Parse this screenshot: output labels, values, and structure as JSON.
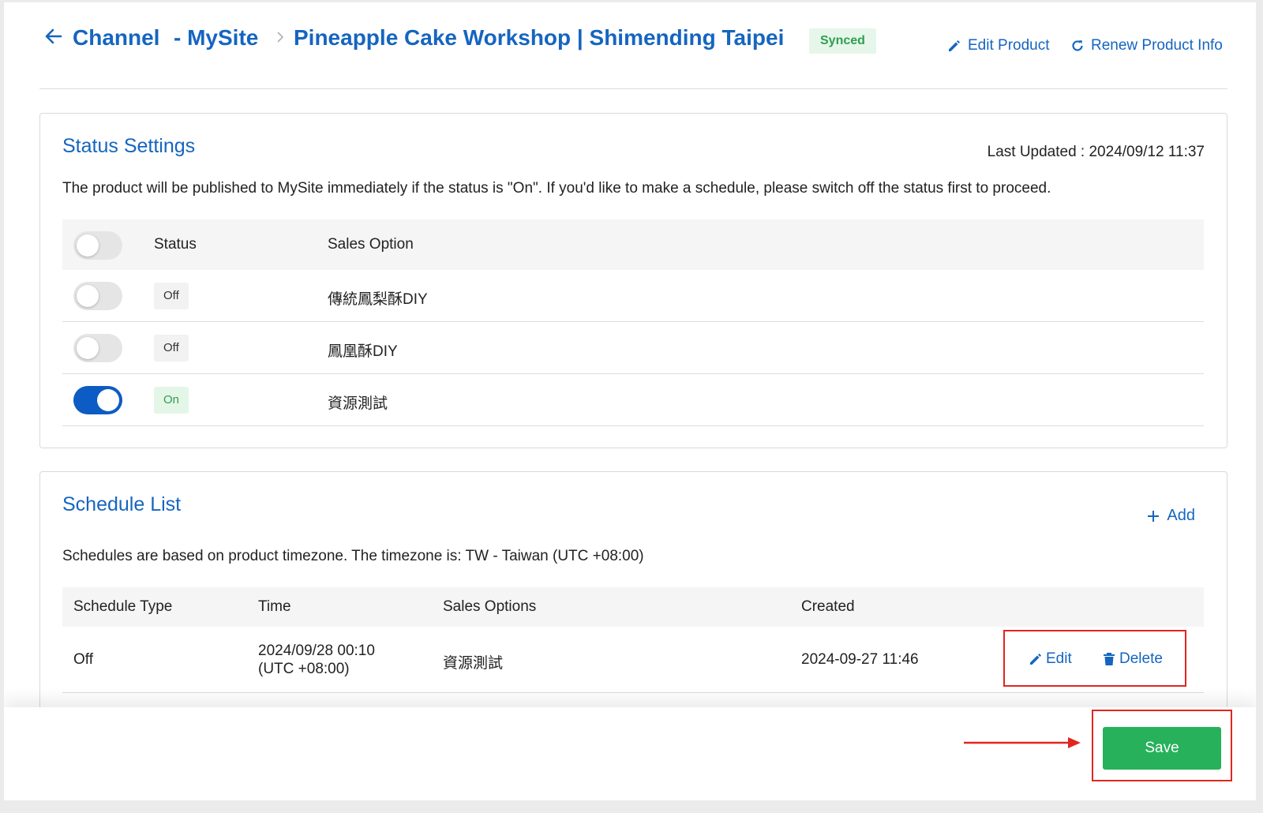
{
  "header": {
    "breadcrumb_channel": "Channel",
    "breadcrumb_site": "- MySite",
    "product_title": "Pineapple Cake Workshop | Shimending Taipei",
    "sync_badge": "Synced",
    "edit_product_label": "Edit Product",
    "renew_product_label": "Renew Product Info"
  },
  "status_settings": {
    "title": "Status Settings",
    "last_updated": "Last Updated : 2024/09/12 11:37",
    "description": "The product will be published to MySite immediately if the status is \"On\". If you'd like to make a schedule, please switch off the status first to proceed.",
    "columns": {
      "status": "Status",
      "sales_option": "Sales Option"
    },
    "rows": [
      {
        "state": "Off",
        "option": "傳統鳳梨酥DIY",
        "enabled": false
      },
      {
        "state": "Off",
        "option": "鳳凰酥DIY",
        "enabled": false
      },
      {
        "state": "On",
        "option": "資源測試",
        "enabled": true
      }
    ]
  },
  "schedule_list": {
    "title": "Schedule List",
    "add_label": "Add",
    "description": "Schedules are based on product timezone. The timezone is: TW - Taiwan (UTC +08:00)",
    "columns": {
      "type": "Schedule Type",
      "time": "Time",
      "sales_options": "Sales Options",
      "created": "Created"
    },
    "rows": [
      {
        "type": "Off",
        "time_line1": "2024/09/28 00:10",
        "time_line2": "(UTC +08:00)",
        "sales_options": "資源測試",
        "created": "2024-09-27 11:46",
        "edit_label": "Edit",
        "delete_label": "Delete"
      }
    ]
  },
  "footer": {
    "save_label": "Save"
  },
  "colors": {
    "accent": "#1565c0",
    "toggle_on": "#0d5bc4",
    "success": "#27b15a",
    "annotation": "#e0261f"
  }
}
